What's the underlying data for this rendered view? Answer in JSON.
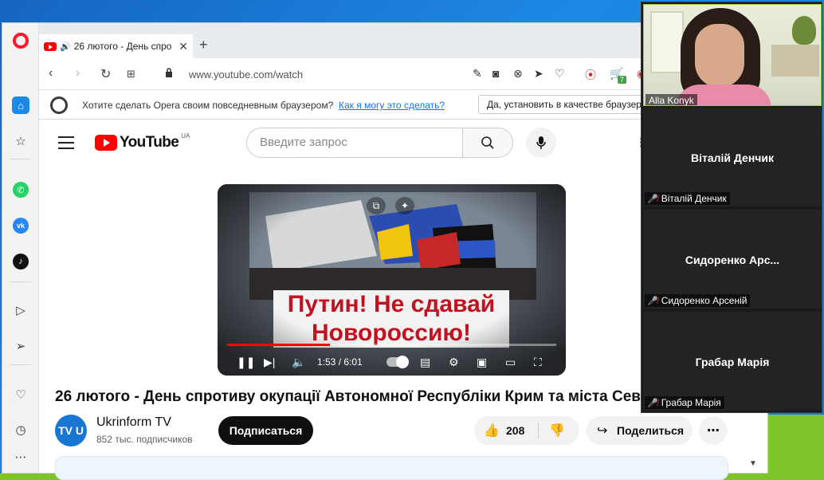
{
  "browser": {
    "tab_title": "26 лютого - День спро",
    "url": "www.youtube.com/watch",
    "ext_badge": "7"
  },
  "opera_bar": {
    "message": "Хотите сделать Opera своим повседневным браузером?",
    "link": "Как я могу это сделать?",
    "yes_button": "Да, установить в качестве браузера"
  },
  "youtube": {
    "logo_text": "YouTube",
    "region": "UA",
    "search_placeholder": "Введите запрос",
    "video": {
      "banner_line1": "Путин! Не сдавай",
      "banner_line2": "Новороссию!",
      "time": "1:53 / 6:01",
      "progress_fraction": 0.313,
      "title": "26 лютого - День спротиву окупації Автономної Республіки Крим та міста Севастополя"
    },
    "channel": {
      "name": "Ukrinform TV",
      "subscribers": "852 тыс. подписчиков",
      "avatar_text": "TV U"
    },
    "subscribe_label": "Подписаться",
    "like_count": "208",
    "share_label": "Поделиться"
  },
  "zoom": {
    "self": {
      "name": "Alla Konyk"
    },
    "participants": [
      {
        "display": "Віталій Денчик",
        "label": "Віталій Денчик"
      },
      {
        "display": "Сидоренко  Арс...",
        "label": "Сидоренко Арсеній"
      },
      {
        "display": "Грабар Марія",
        "label": "Грабар Марія"
      }
    ]
  },
  "colors": {
    "accent_blue": "#1e88e5",
    "youtube_red": "#ff0000",
    "opera_red": "#ff1b2d",
    "desktop_green": "#7cc42a"
  }
}
